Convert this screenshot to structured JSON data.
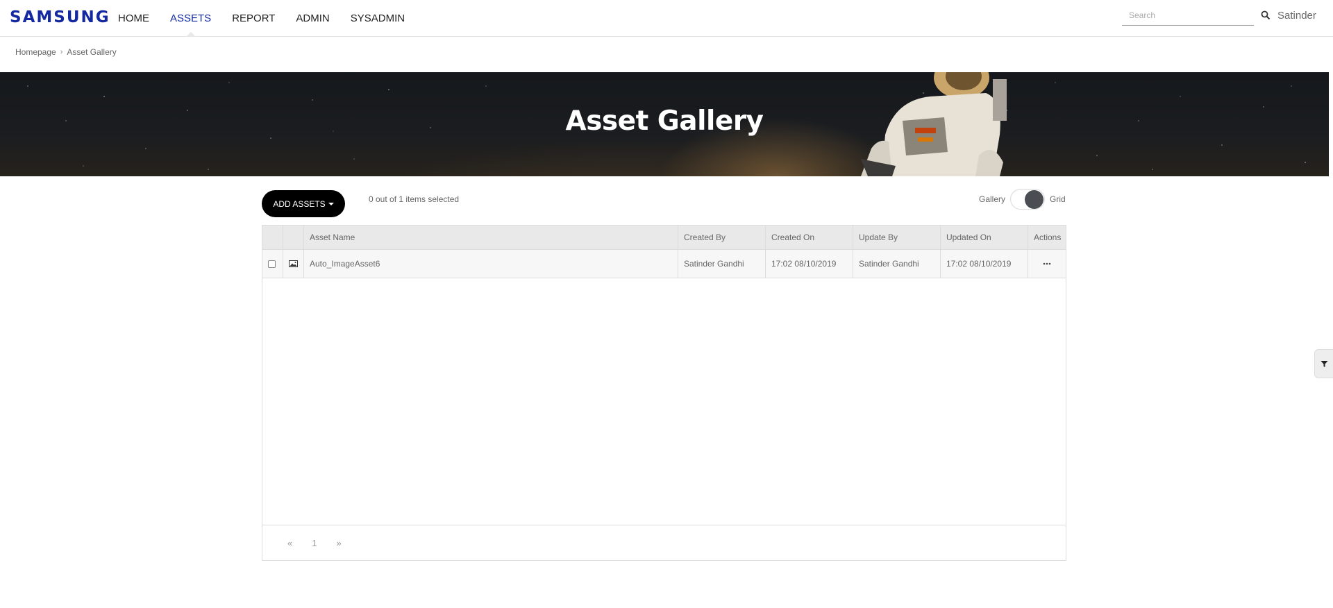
{
  "header": {
    "logo": "SAMSUNG",
    "nav": [
      "HOME",
      "ASSETS",
      "REPORT",
      "ADMIN",
      "SYSADMIN"
    ],
    "active_nav": "ASSETS",
    "search_placeholder": "Search",
    "search_value": "",
    "user": "Satinder"
  },
  "breadcrumb": {
    "items": [
      "Homepage",
      "Asset Gallery"
    ],
    "separator": "›"
  },
  "hero": {
    "title": "Asset Gallery"
  },
  "toolbar": {
    "add_assets_label": "ADD ASSETS",
    "selection_text": "0 out of 1 items selected",
    "view_left_label": "Gallery",
    "view_right_label": "Grid",
    "view_selected": "Grid"
  },
  "table": {
    "columns": [
      "Asset Name",
      "Created By",
      "Created On",
      "Update By",
      "Updated On",
      "Actions"
    ],
    "rows": [
      {
        "asset_name": "Auto_ImageAsset6",
        "type_icon": "image-icon",
        "created_by": "Satinder Gandhi",
        "created_on": "17:02 08/10/2019",
        "update_by": "Satinder Gandhi",
        "updated_on": "17:02 08/10/2019",
        "actions_icon": "more-horizontal-icon",
        "checked": false
      }
    ]
  },
  "pagination": {
    "prev": "«",
    "page": "1",
    "next": "»"
  },
  "colors": {
    "brand": "#1428a0",
    "button": "#000000",
    "toggle_knob": "#4a4d52"
  }
}
